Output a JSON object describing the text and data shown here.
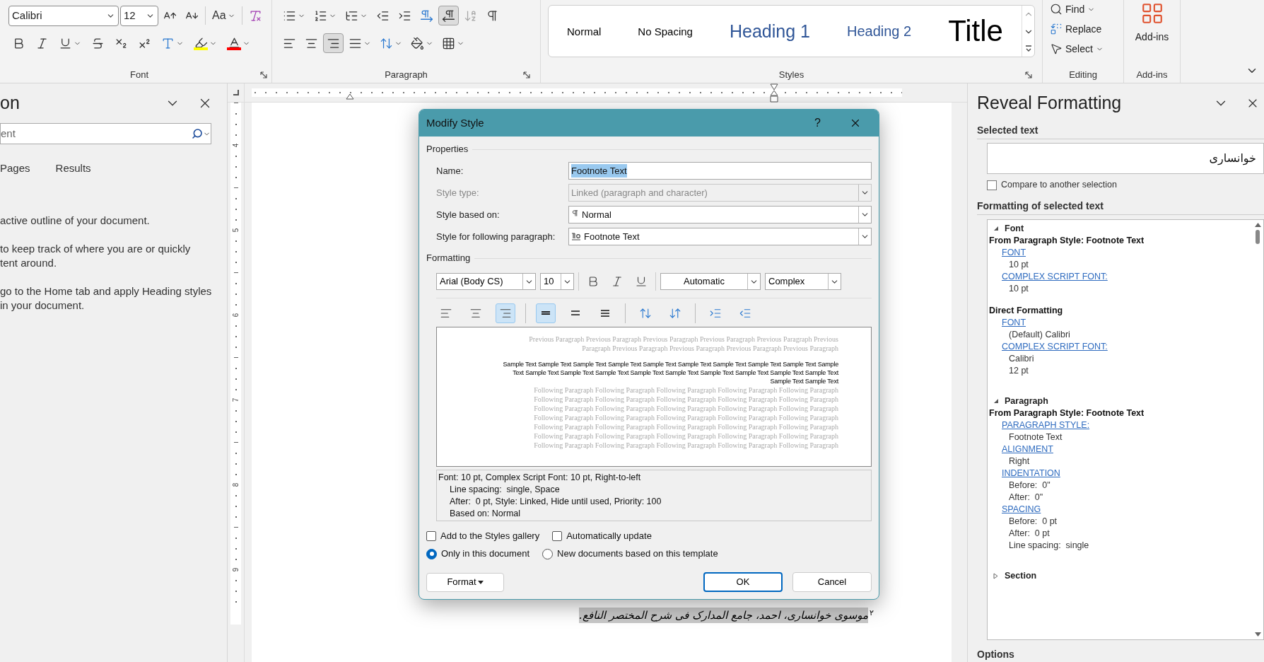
{
  "ribbon": {
    "font": {
      "label": "Font",
      "font_name": "Calibri",
      "font_size": "12",
      "row1": [
        {
          "kind": "grow",
          "dropdown": false
        },
        {
          "kind": "shrink",
          "dropdown": false
        },
        {
          "kind": "case",
          "label": "Aa",
          "dropdown": true
        },
        {
          "kind": "clear",
          "dropdown": false
        }
      ],
      "row2": [
        {
          "kind": "bold",
          "dropdown": false
        },
        {
          "kind": "italic",
          "dropdown": false
        },
        {
          "kind": "underline",
          "dropdown": true
        },
        {
          "kind": "strike",
          "dropdown": false
        },
        {
          "kind": "subscript",
          "dropdown": false
        },
        {
          "kind": "superscript",
          "dropdown": false
        },
        {
          "kind": "effects",
          "dropdown": true
        },
        {
          "kind": "highlight",
          "dropdown": true,
          "color": "#ffff00"
        },
        {
          "kind": "font-color",
          "dropdown": true,
          "color": "#ff0000"
        }
      ]
    },
    "paragraph": {
      "label": "Paragraph",
      "row1": [
        {
          "kind": "bullets",
          "dropdown": true,
          "selected": false,
          "disabled": false
        },
        {
          "kind": "numbering",
          "dropdown": true,
          "selected": false,
          "disabled": false
        },
        {
          "kind": "multilevel",
          "dropdown": true,
          "selected": false,
          "disabled": false
        },
        {
          "kind": "outdent",
          "dropdown": false,
          "selected": false,
          "disabled": false
        },
        {
          "kind": "indent",
          "dropdown": false,
          "selected": false,
          "disabled": false
        },
        {
          "kind": "ltr",
          "dropdown": false,
          "selected": false,
          "disabled": false
        },
        {
          "kind": "rtl",
          "dropdown": false,
          "selected": true,
          "disabled": false
        },
        {
          "kind": "sort",
          "dropdown": false,
          "selected": false,
          "disabled": true
        },
        {
          "kind": "marks",
          "dropdown": false,
          "selected": false,
          "disabled": false
        }
      ],
      "row2": [
        {
          "kind": "align-left",
          "dropdown": false,
          "selected": false,
          "disabled": false
        },
        {
          "kind": "align-center",
          "dropdown": false,
          "selected": false,
          "disabled": false
        },
        {
          "kind": "align-right",
          "dropdown": false,
          "selected": true,
          "disabled": false
        },
        {
          "kind": "justify",
          "dropdown": true,
          "selected": false,
          "disabled": false
        },
        {
          "kind": "line-spacing",
          "dropdown": true,
          "selected": false,
          "disabled": false
        },
        {
          "kind": "shading",
          "dropdown": true,
          "selected": false,
          "disabled": false
        },
        {
          "kind": "borders",
          "dropdown": true,
          "selected": false,
          "disabled": false
        }
      ]
    },
    "styles": {
      "label": "Styles",
      "items": [
        {
          "name": "Normal",
          "kind": "normal"
        },
        {
          "name": "No Spacing",
          "kind": "normal"
        },
        {
          "name": "Heading 1",
          "kind": "heading1"
        },
        {
          "name": "Heading 2",
          "kind": "heading2"
        },
        {
          "name": "Title",
          "kind": "title"
        }
      ]
    },
    "editing": {
      "label": "Editing",
      "items": [
        {
          "kind": "find",
          "label": "Find",
          "dropdown": true
        },
        {
          "kind": "replace",
          "label": "Replace",
          "dropdown": false
        },
        {
          "kind": "select",
          "label": "Select",
          "dropdown": true
        }
      ]
    },
    "addins": {
      "label": "Add-ins",
      "button": "Add-ins"
    }
  },
  "nav_pane": {
    "title": "on",
    "search_placeholder": "ent",
    "tabs": [
      {
        "label": "Pages"
      },
      {
        "label": "Results"
      }
    ],
    "paragraphs": [
      [
        "active outline of your document."
      ],
      [
        "to keep track of where you are or quickly",
        "tent around."
      ],
      [
        "go to the Home tab and apply Heading styles",
        "in your document."
      ]
    ]
  },
  "vertical_ruler": [
    "4",
    "5",
    "6",
    "7",
    "8",
    "9"
  ],
  "document": {
    "footnote_marker": "۲",
    "footnote_text": "موسوی خوانساری، احمد، جامع المدارک فی شرح المختصر النافع."
  },
  "dialog": {
    "title": "Modify Style",
    "help": "?",
    "properties_label": "Properties",
    "properties": [
      {
        "label": "Name:",
        "value": "Footnote Text",
        "kind": "text",
        "disabled": false,
        "selected": true
      },
      {
        "label": "Style type:",
        "value": "Linked (paragraph and character)",
        "kind": "dropdown",
        "disabled": true,
        "selected": false
      },
      {
        "label": "Style based on:",
        "value": "Normal",
        "kind": "paragraph-style",
        "disabled": false,
        "selected": false
      },
      {
        "label": "Style for following paragraph:",
        "value": "Footnote Text",
        "kind": "linked-style",
        "disabled": false,
        "selected": false
      }
    ],
    "formatting_label": "Formatting",
    "font": "Arial (Body CS)",
    "size": "10",
    "font_color": "Automatic",
    "script": "Complex",
    "text_tools": [
      {
        "kind": "bold",
        "selected": false
      },
      {
        "kind": "italic",
        "selected": false
      },
      {
        "kind": "underline",
        "selected": false
      }
    ],
    "paragraph_tools": [
      [
        {
          "kind": "align-left",
          "selected": false
        },
        {
          "kind": "align-center",
          "selected": false
        },
        {
          "kind": "align-right",
          "selected": true
        }
      ],
      [
        {
          "kind": "single",
          "selected": true
        },
        {
          "kind": "one-half",
          "selected": false
        },
        {
          "kind": "double",
          "selected": false
        }
      ],
      [
        {
          "kind": "space-increase",
          "selected": false
        },
        {
          "kind": "space-decrease",
          "selected": false
        }
      ],
      [
        {
          "kind": "indent-increase",
          "selected": false
        },
        {
          "kind": "indent-decrease",
          "selected": false
        }
      ]
    ],
    "preview": {
      "previous": [
        "Previous Paragraph Previous Paragraph Previous Paragraph Previous Paragraph Previous Paragraph Previous",
        "Paragraph Previous Paragraph Previous Paragraph Previous Paragraph Previous Paragraph"
      ],
      "sample": [
        "Sample Text Sample Text Sample Text Sample Text Sample Text Sample Text Sample Text Sample Text Sample Text Sample",
        "Text Sample Text Sample Text Sample Text Sample Text Sample Text Sample Text Sample Text Sample Text Sample Text",
        "Sample Text Sample Text"
      ],
      "following": [
        "Following Paragraph Following Paragraph Following Paragraph Following Paragraph Following Paragraph",
        "Following Paragraph Following Paragraph Following Paragraph Following Paragraph Following Paragraph",
        "Following Paragraph Following Paragraph Following Paragraph Following Paragraph Following Paragraph",
        "Following Paragraph Following Paragraph Following Paragraph Following Paragraph Following Paragraph",
        "Following Paragraph Following Paragraph Following Paragraph Following Paragraph Following Paragraph",
        "Following Paragraph Following Paragraph Following Paragraph Following Paragraph Following Paragraph",
        "Following Paragraph Following Paragraph Following Paragraph Following Paragraph Following Paragraph"
      ]
    },
    "description": [
      "Font: 10 pt, Complex Script Font: 10 pt, Right-to-left",
      "Line spacing:  single, Space",
      "After:  0 pt, Style: Linked, Hide until used, Priority: 100",
      "Based on: Normal"
    ],
    "checkboxes": [
      {
        "label": "Add to the Styles gallery",
        "checked": false
      },
      {
        "label": "Automatically update",
        "checked": false
      }
    ],
    "radios": [
      {
        "label": "Only in this document",
        "selected": true
      },
      {
        "label": "New documents based on this template",
        "selected": false
      }
    ],
    "format_button": "Format",
    "ok": "OK",
    "cancel": "Cancel"
  },
  "reveal_pane": {
    "title": "Reveal Formatting",
    "selected_label": "Selected text",
    "selected_text": "خوانساری",
    "compare": {
      "label": "Compare to another selection",
      "checked": false
    },
    "formatting_label": "Formatting of selected text",
    "sections": [
      {
        "title": "Font",
        "expanded": true,
        "groups": [
          {
            "heading": "From Paragraph Style: Footnote Text",
            "items": [
              {
                "link": "FONT",
                "values": [
                  "10 pt"
                ]
              },
              {
                "link": "COMPLEX SCRIPT FONT:",
                "values": [
                  "10 pt"
                ]
              }
            ]
          },
          {
            "heading": "Direct Formatting",
            "items": [
              {
                "link": "FONT",
                "values": [
                  "(Default) Calibri"
                ]
              },
              {
                "link": "COMPLEX SCRIPT FONT:",
                "values": [
                  "Calibri",
                  "12 pt"
                ]
              }
            ]
          }
        ]
      },
      {
        "title": "Paragraph",
        "expanded": true,
        "groups": [
          {
            "heading": "From Paragraph Style: Footnote Text",
            "items": [
              {
                "link": "PARAGRAPH STYLE:",
                "values": [
                  "Footnote Text"
                ]
              },
              {
                "link": "ALIGNMENT",
                "values": [
                  "Right"
                ]
              },
              {
                "link": "INDENTATION",
                "values": [
                  "Before:  0\"",
                  "After:  0\""
                ]
              },
              {
                "link": "SPACING",
                "values": [
                  "Before:  0 pt",
                  "After:  0 pt",
                  "Line spacing:  single"
                ]
              }
            ]
          }
        ]
      },
      {
        "title": "Section",
        "expanded": false
      }
    ],
    "options": "Options"
  }
}
